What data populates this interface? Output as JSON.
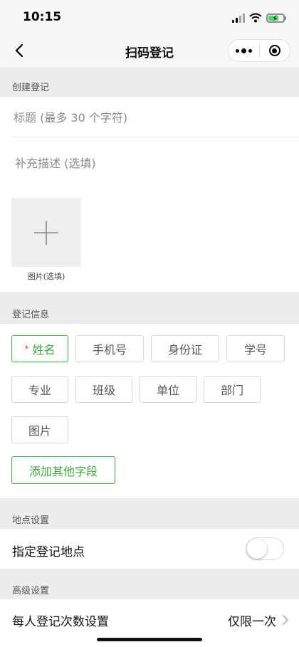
{
  "status_bar": {
    "time": "10:15"
  },
  "navbar": {
    "title": "扫码登记"
  },
  "create_section": {
    "header": "创建登记",
    "title_placeholder": "标题 (最多 30 个字符)",
    "description_placeholder": "补充描述 (选填)",
    "image_label": "图片(选填)"
  },
  "info_section": {
    "header": "登记信息",
    "fields": [
      {
        "label": "姓名",
        "required": true,
        "selected": true
      },
      {
        "label": "手机号",
        "required": false,
        "selected": false
      },
      {
        "label": "身份证",
        "required": false,
        "selected": false
      },
      {
        "label": "学号",
        "required": false,
        "selected": false
      },
      {
        "label": "专业",
        "required": false,
        "selected": false
      },
      {
        "label": "班级",
        "required": false,
        "selected": false
      },
      {
        "label": "单位",
        "required": false,
        "selected": false
      },
      {
        "label": "部门",
        "required": false,
        "selected": false
      },
      {
        "label": "图片",
        "required": false,
        "selected": false
      }
    ],
    "required_mark": "*",
    "add_field_label": "添加其他字段"
  },
  "location_section": {
    "header": "地点设置",
    "specify_location_label": "指定登记地点",
    "specify_location_enabled": false
  },
  "advanced_section": {
    "header": "高级设置",
    "count_label": "每人登记次数设置",
    "count_value": "仅限一次"
  },
  "colors": {
    "accent": "#3caa3c",
    "required": "#e64340",
    "page_background": "#ededed",
    "battery": "#4cd964"
  }
}
